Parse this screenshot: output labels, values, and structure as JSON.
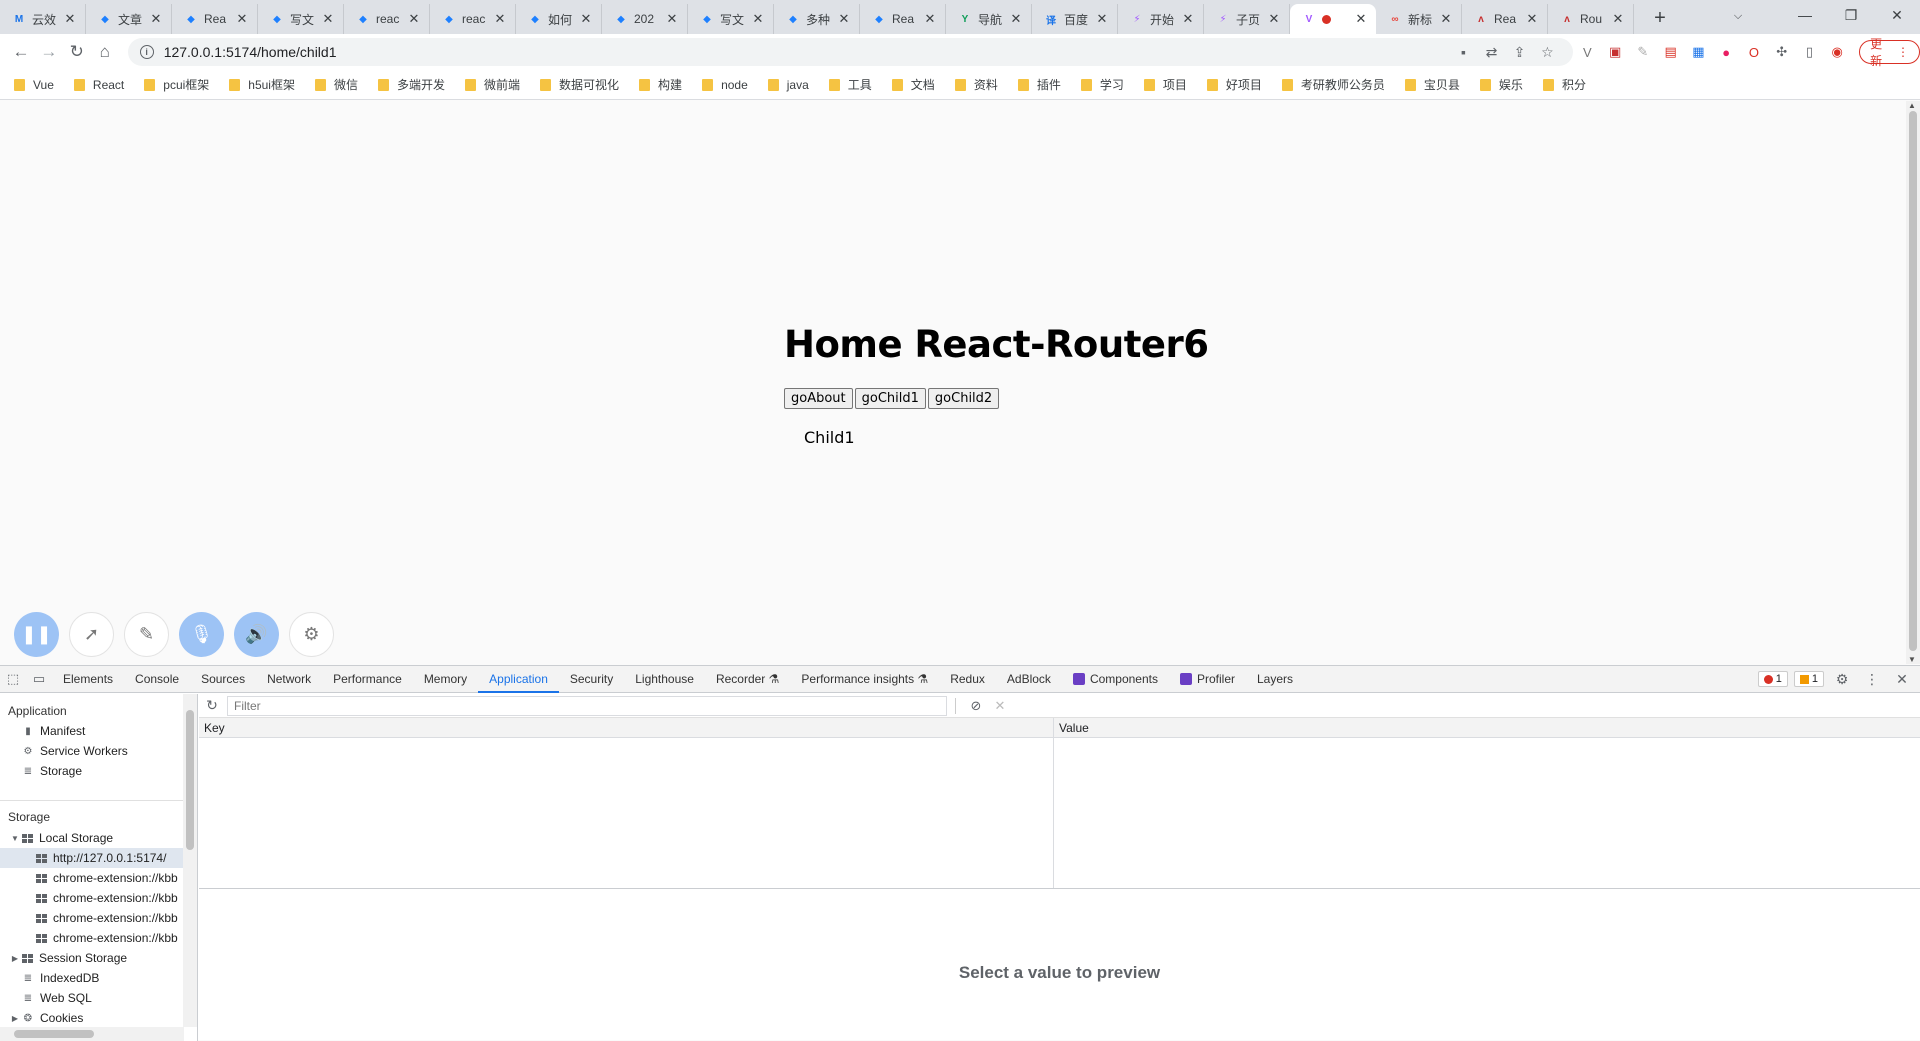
{
  "browser": {
    "tabs": [
      {
        "title": "云效",
        "fav": "M",
        "fav_color": "#1a73e8"
      },
      {
        "title": "文章",
        "fav": "◆",
        "fav_color": "#1e80ff"
      },
      {
        "title": "Rea",
        "fav": "◆",
        "fav_color": "#1e80ff"
      },
      {
        "title": "写文",
        "fav": "◆",
        "fav_color": "#1e80ff"
      },
      {
        "title": "reac",
        "fav": "◆",
        "fav_color": "#1e80ff"
      },
      {
        "title": "reac",
        "fav": "◆",
        "fav_color": "#1e80ff"
      },
      {
        "title": "如何",
        "fav": "◆",
        "fav_color": "#1e80ff"
      },
      {
        "title": "202",
        "fav": "◆",
        "fav_color": "#1e80ff"
      },
      {
        "title": "写文",
        "fav": "◆",
        "fav_color": "#1e80ff"
      },
      {
        "title": "多种",
        "fav": "◆",
        "fav_color": "#1e80ff"
      },
      {
        "title": "Rea",
        "fav": "◆",
        "fav_color": "#1e80ff"
      },
      {
        "title": "导航",
        "fav": "Y",
        "fav_color": "#0f9d58"
      },
      {
        "title": "百度",
        "fav": "译",
        "fav_color": "#1a73e8"
      },
      {
        "title": "开始",
        "fav": "⚡",
        "fav_color": "#a259ff"
      },
      {
        "title": "子页",
        "fav": "⚡",
        "fav_color": "#a259ff"
      },
      {
        "title": "",
        "fav": "V",
        "fav_color": "#a259ff",
        "active": true
      },
      {
        "title": "新标",
        "fav": "∞",
        "fav_color": "#e8453c"
      },
      {
        "title": "Rea",
        "fav": "ᴧ",
        "fav_color": "#c62f2f"
      },
      {
        "title": "Rou",
        "fav": "ᴧ",
        "fav_color": "#c62f2f"
      }
    ],
    "url": "127.0.0.1:5174/home/child1",
    "update_label": "更新",
    "bookmarks": [
      "Vue",
      "React",
      "pcui框架",
      "h5ui框架",
      "微信",
      "多端开发",
      "微前端",
      "数据可视化",
      "构建",
      "node",
      "java",
      "工具",
      "文档",
      "资料",
      "插件",
      "学习",
      "项目",
      "好项目",
      "考研教师公务员",
      "宝贝县",
      "娱乐",
      "积分"
    ]
  },
  "page": {
    "title": "Home React-Router6",
    "buttons": [
      "goAbout",
      "goChild1",
      "goChild2"
    ],
    "child_text": "Child1"
  },
  "devtools": {
    "tabs": [
      "Elements",
      "Console",
      "Sources",
      "Network",
      "Performance",
      "Memory",
      "Application",
      "Security",
      "Lighthouse",
      "Recorder ⚗",
      "Performance insights ⚗",
      "Redux",
      "AdBlock",
      "Components",
      "Profiler",
      "Layers"
    ],
    "active_tab": "Application",
    "errors": "1",
    "warnings": "1",
    "sidebar": {
      "application_header": "Application",
      "application_items": [
        "Manifest",
        "Service Workers",
        "Storage"
      ],
      "storage_header": "Storage",
      "local_storage": "Local Storage",
      "local_storage_items": [
        "http://127.0.0.1:5174/",
        "chrome-extension://kbb",
        "chrome-extension://kbb",
        "chrome-extension://kbb",
        "chrome-extension://kbb"
      ],
      "session_storage": "Session Storage",
      "indexeddb": "IndexedDB",
      "websql": "Web SQL",
      "cookies": "Cookies"
    },
    "filter_placeholder": "Filter",
    "columns": {
      "key": "Key",
      "value": "Value"
    },
    "preview_text": "Select a value to preview"
  }
}
